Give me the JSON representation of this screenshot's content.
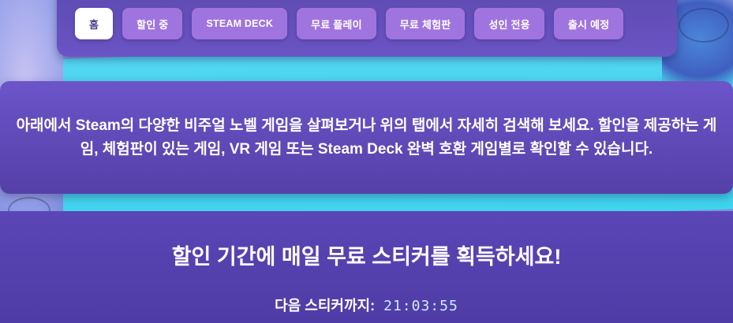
{
  "tabs": [
    {
      "label": "홈",
      "active": true
    },
    {
      "label": "할인 중"
    },
    {
      "label": "STEAM DECK"
    },
    {
      "label": "무료 플레이"
    },
    {
      "label": "무료 체험판"
    },
    {
      "label": "성인 전용"
    },
    {
      "label": "출시 예정"
    }
  ],
  "info": {
    "text": "아래에서 Steam의 다양한 비주얼 노벨 게임을 살펴보거나 위의 탭에서 자세히 검색해 보세요. 할인을 제공하는 게임, 체험판이 있는 게임, VR 게임 또는 Steam Deck 완벽 호환 게임별로 확인할 수 있습니다."
  },
  "sticker": {
    "title": "할인 기간에 매일 무료 스티커를 획득하세요!",
    "countdown_label": "다음 스티커까지:",
    "countdown_time": "21:03:55"
  },
  "colors": {
    "panel": "#5a46b5",
    "tab": "#a074de",
    "tab_active": "#ffffff",
    "accent_cyan": "#3fd4ee"
  }
}
